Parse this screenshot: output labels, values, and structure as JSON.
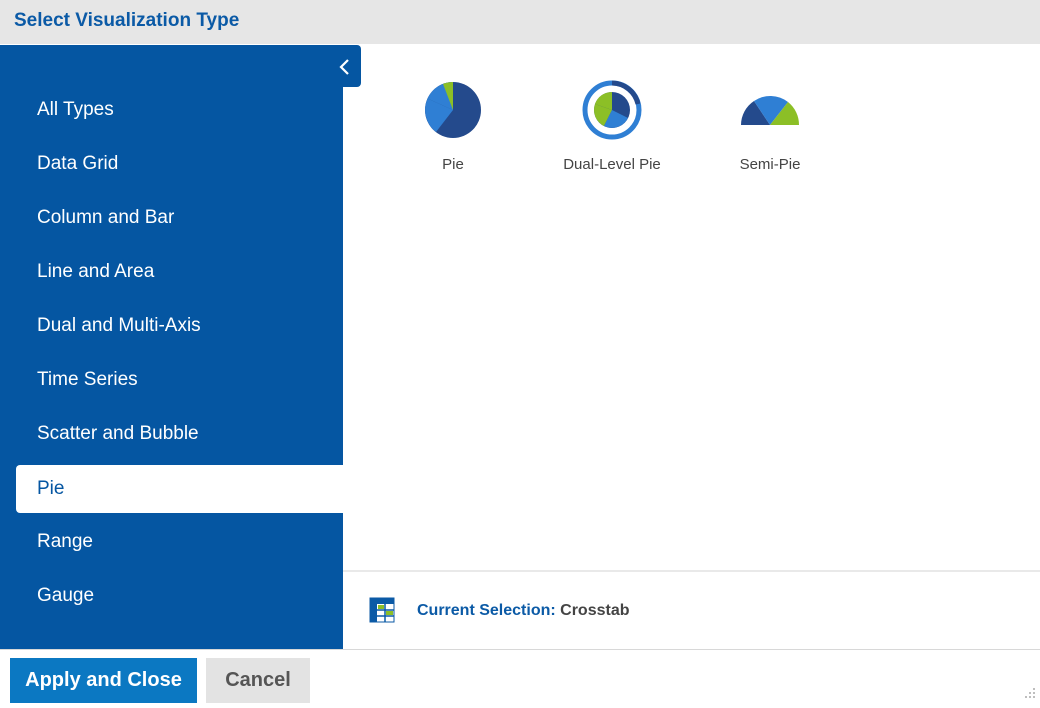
{
  "dialog": {
    "title": "Select Visualization Type"
  },
  "sidebar": {
    "collapse_icon": "chevron-left-icon",
    "items": [
      {
        "label": "All Types",
        "selected": false
      },
      {
        "label": "Data Grid",
        "selected": false
      },
      {
        "label": "Column and Bar",
        "selected": false
      },
      {
        "label": "Line and Area",
        "selected": false
      },
      {
        "label": "Dual and Multi-Axis",
        "selected": false
      },
      {
        "label": "Time Series",
        "selected": false
      },
      {
        "label": "Scatter and Bubble",
        "selected": false
      },
      {
        "label": "Pie",
        "selected": true
      },
      {
        "label": "Range",
        "selected": false
      },
      {
        "label": "Gauge",
        "selected": false
      }
    ]
  },
  "visualizations": [
    {
      "label": "Pie",
      "icon": "pie-chart-icon"
    },
    {
      "label": "Dual-Level Pie",
      "icon": "dual-level-pie-icon"
    },
    {
      "label": "Semi-Pie",
      "icon": "semi-pie-icon"
    }
  ],
  "current_selection": {
    "label": "Current Selection:",
    "value": "Crosstab",
    "icon": "crosstab-icon"
  },
  "footer": {
    "apply_label": "Apply and Close",
    "cancel_label": "Cancel"
  },
  "colors": {
    "brand_blue": "#0556a2",
    "apply_blue": "#0b78c2",
    "pie_dark": "#244a8c",
    "pie_mid": "#2f7fd4",
    "pie_green": "#8cbf26"
  }
}
